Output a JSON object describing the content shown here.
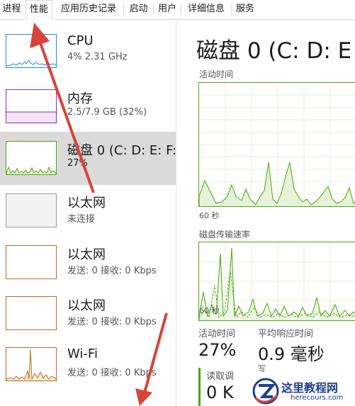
{
  "tabs": [
    {
      "label": "进程",
      "active": false
    },
    {
      "label": "性能",
      "active": true
    },
    {
      "label": "应用历史记录",
      "active": false
    },
    {
      "label": "启动",
      "active": false
    },
    {
      "label": "用户",
      "active": false
    },
    {
      "label": "详细信息",
      "active": false
    },
    {
      "label": "服务",
      "active": false
    }
  ],
  "sidebar": {
    "items": [
      {
        "title": "CPU",
        "subtitle": "4% 2.31 GHz",
        "color": "#1e8fcf",
        "selected": false
      },
      {
        "title": "内存",
        "subtitle": "2.5/7.9 GB (32%)",
        "color": "#8b2fa8",
        "selected": false
      },
      {
        "title": "磁盘 0 (C: D: E: F:",
        "subtitle": "27%",
        "color": "#4da60c",
        "selected": true
      },
      {
        "title": "以太网",
        "subtitle": "未连接",
        "color": "#9a9a9a",
        "selected": false
      },
      {
        "title": "以太网",
        "subtitle": "发送: 0 接收: 0 Kbps",
        "color": "#c26a1a",
        "selected": false
      },
      {
        "title": "以太网",
        "subtitle": "发送: 0 接收: 0 Kbps",
        "color": "#c26a1a",
        "selected": false
      },
      {
        "title": "Wi-Fi",
        "subtitle": "发送: 0 接收: 0 Kbps",
        "color": "#c26a1a",
        "selected": false
      }
    ]
  },
  "main": {
    "title": "磁盘 0 (C: D: E",
    "activity_label": "活动时间",
    "activity_time_label": "60 秒",
    "transfer_label": "磁盘传输速率",
    "transfer_time_label": "60 秒",
    "stats": {
      "active_time_label": "活动时间",
      "active_time_value": "27%",
      "response_label": "平均响应时间",
      "response_value": "0.9 毫秒",
      "read_label": "读取调",
      "read_value": "0 K",
      "write_label": "写"
    }
  },
  "watermark": {
    "name": "这里教程网",
    "url": "herecours.com"
  },
  "colors": {
    "disk_green": "#4da60c",
    "arrow_red": "#d9443a",
    "watermark_blue": "#1f3f8f"
  }
}
